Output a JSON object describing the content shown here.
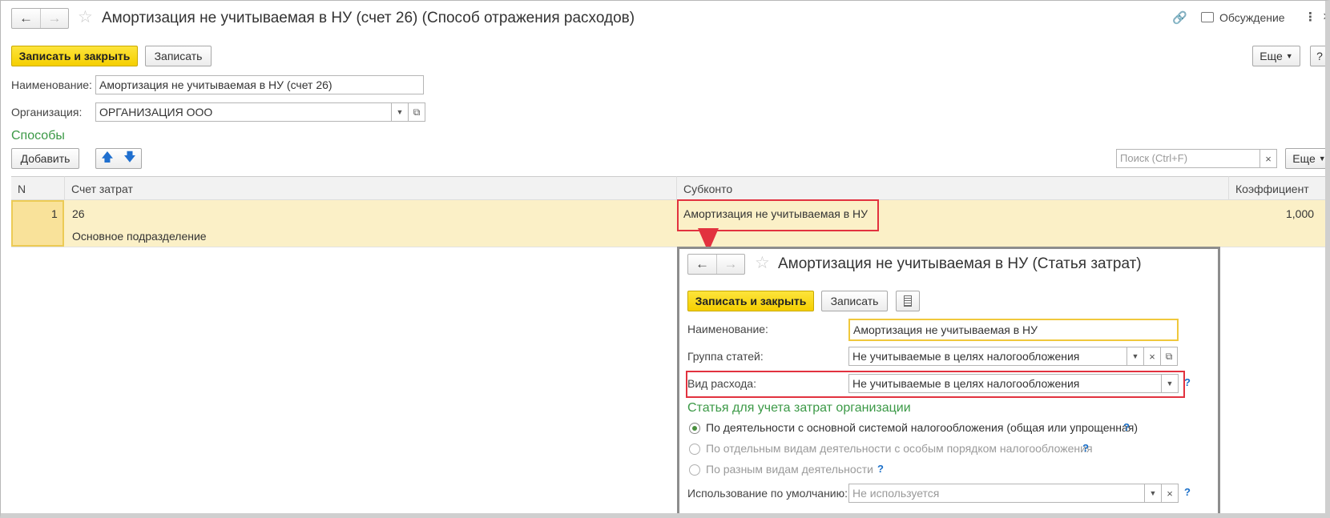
{
  "main": {
    "title": "Амортизация не учитываемая в НУ (счет 26) (Способ отражения расходов)",
    "discussion_label": "Обсуждение",
    "save_close_label": "Записать и закрыть",
    "save_label": "Записать",
    "more_label": "Еще",
    "help_label": "?",
    "name_label": "Наименование:",
    "name_value": "Амортизация не учитываемая в НУ (счет 26)",
    "org_label": "Организация:",
    "org_value": "ОРГАНИЗАЦИЯ ООО"
  },
  "methods": {
    "section_title": "Способы",
    "add_label": "Добавить",
    "search_placeholder": "Поиск (Ctrl+F)",
    "more_label": "Еще",
    "columns": [
      "N",
      "Счет затрат",
      "Субконто",
      "Коэффициент"
    ],
    "rows": [
      {
        "n": "1",
        "account": "26",
        "subdivision": "Основное подразделение",
        "subconto": "Амортизация не учитываемая в НУ",
        "coefficient": "1,000"
      }
    ]
  },
  "popup": {
    "title": "Амортизация не учитываемая в НУ (Статья затрат)",
    "save_close_label": "Записать и закрыть",
    "save_label": "Записать",
    "name_label": "Наименование:",
    "name_value": "Амортизация не учитываемая в НУ",
    "group_label": "Группа статей:",
    "group_value": "Не учитываемые в целях налогообложения",
    "expense_type_label": "Вид расхода:",
    "expense_type_value": "Не учитываемые в целях налогообложения",
    "section_title": "Статья для учета затрат организации",
    "options": [
      {
        "label": "По деятельности с основной системой налогообложения (общая или упрощенная)",
        "selected": true,
        "enabled": true
      },
      {
        "label": "По отдельным видам деятельности с особым порядком налогообложения",
        "selected": false,
        "enabled": false
      },
      {
        "label": "По разным видам деятельности",
        "selected": false,
        "enabled": false
      }
    ],
    "default_use_label": "Использование по умолчанию:",
    "default_use_placeholder": "Не используется"
  },
  "colors": {
    "accent_yellow": "#f5cf00",
    "section_green": "#3b9946",
    "highlight_red": "#e2323f",
    "row_highlight": "#fbf0c7",
    "help_blue": "#1a6fc9"
  }
}
